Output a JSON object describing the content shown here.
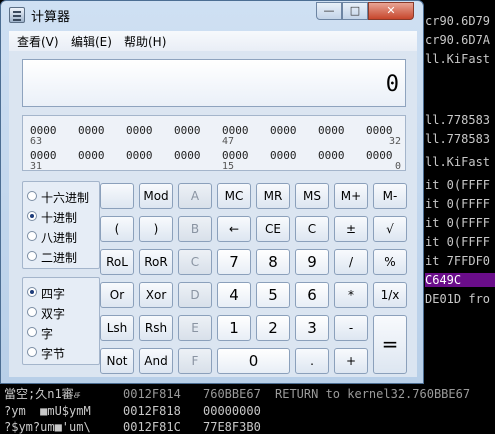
{
  "console": {
    "lines": [
      {
        "text": "cr90.6D79",
        "highlight": false
      },
      {
        "text": "cr90.6D7A",
        "highlight": false
      },
      {
        "text": "ll.KiFast",
        "highlight": false
      },
      {
        "text": "ll.778583",
        "highlight": false
      },
      {
        "text": "ll.778583",
        "highlight": false
      },
      {
        "text": "ll.KiFast",
        "highlight": false
      },
      {
        "text": "it 0(FFFF",
        "highlight": false
      },
      {
        "text": "it 0(FFFF",
        "highlight": false
      },
      {
        "text": "it 0(FFFF",
        "highlight": false
      },
      {
        "text": "it 0(FFFF",
        "highlight": false
      },
      {
        "text": "it 7FFDF0",
        "highlight": false
      },
      {
        "text": "C649C",
        "highlight": true
      },
      {
        "text": "DE01D fro",
        "highlight": false
      }
    ],
    "bottom": [
      "當空;久n1審ச",
      "?ym  ■mU$ymM",
      "?$ym?um■'um\\"
    ],
    "addresses": [
      "0012F814",
      "0012F818",
      "0012F81C"
    ],
    "values": [
      "760BBE67",
      "00000000",
      "77E8F3B0"
    ],
    "comment": "RETURN to kernel32.760BBE67"
  },
  "window": {
    "title": "计算器",
    "min_label": "—",
    "max_label": "□",
    "close_label": "✕",
    "accent": "#c7462c"
  },
  "menu": [
    "查看(V)",
    "编辑(E)",
    "帮助(H)"
  ],
  "display": {
    "value": "0"
  },
  "bits": {
    "row1": [
      "0000",
      "0000",
      "0000",
      "0000",
      "0000",
      "0000",
      "0000",
      "0000"
    ],
    "row1_idx": [
      "63",
      "47",
      "32"
    ],
    "row2": [
      "0000",
      "0000",
      "0000",
      "0000",
      "0000",
      "0000",
      "0000",
      "0000"
    ],
    "row2_idx": [
      "31",
      "15",
      "0"
    ]
  },
  "base": {
    "options": [
      "十六进制",
      "十进制",
      "八进制",
      "二进制"
    ],
    "selected": "十进制"
  },
  "word": {
    "options": [
      "四字",
      "双字",
      "字",
      "字节"
    ],
    "selected": "四字"
  },
  "keys": [
    [
      "",
      "Mod",
      "A",
      "MC",
      "MR",
      "MS",
      "M+",
      "M-"
    ],
    [
      "(",
      ")",
      "B",
      "←",
      "CE",
      "C",
      "±",
      "√"
    ],
    [
      "RoL",
      "RoR",
      "C",
      "7",
      "8",
      "9",
      "/",
      "%"
    ],
    [
      "Or",
      "Xor",
      "D",
      "4",
      "5",
      "6",
      "*",
      "1/x"
    ],
    [
      "Lsh",
      "Rsh",
      "E",
      "1",
      "2",
      "3",
      "-",
      "="
    ],
    [
      "Not",
      "And",
      "F",
      "0",
      ".",
      "+"
    ]
  ]
}
